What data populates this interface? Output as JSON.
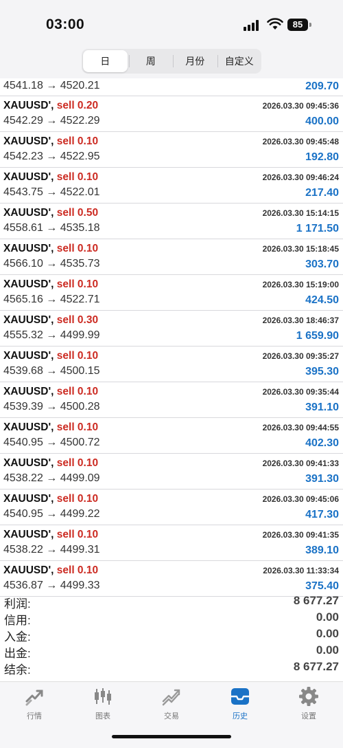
{
  "status": {
    "time": "03:00",
    "battery": "85"
  },
  "tabs": [
    "日",
    "周",
    "月份",
    "自定义"
  ],
  "partial_row": {
    "prices": "4541.18 → 4520.21",
    "profit": "209.70"
  },
  "rows": [
    {
      "symbol": "XAUUSD',",
      "side": "sell 0.20",
      "date": "2026.03.30 09:45:36",
      "prices": "4542.29 → 4522.29",
      "profit": "400.00"
    },
    {
      "symbol": "XAUUSD',",
      "side": "sell 0.10",
      "date": "2026.03.30 09:45:48",
      "prices": "4542.23 → 4522.95",
      "profit": "192.80"
    },
    {
      "symbol": "XAUUSD',",
      "side": "sell 0.10",
      "date": "2026.03.30 09:46:24",
      "prices": "4543.75 → 4522.01",
      "profit": "217.40"
    },
    {
      "symbol": "XAUUSD',",
      "side": "sell 0.50",
      "date": "2026.03.30 15:14:15",
      "prices": "4558.61 → 4535.18",
      "profit": "1 171.50"
    },
    {
      "symbol": "XAUUSD',",
      "side": "sell 0.10",
      "date": "2026.03.30 15:18:45",
      "prices": "4566.10 → 4535.73",
      "profit": "303.70"
    },
    {
      "symbol": "XAUUSD',",
      "side": "sell 0.10",
      "date": "2026.03.30 15:19:00",
      "prices": "4565.16 → 4522.71",
      "profit": "424.50"
    },
    {
      "symbol": "XAUUSD',",
      "side": "sell 0.30",
      "date": "2026.03.30 18:46:37",
      "prices": "4555.32 → 4499.99",
      "profit": "1 659.90"
    },
    {
      "symbol": "XAUUSD',",
      "side": "sell 0.10",
      "date": "2026.03.30 09:35:27",
      "prices": "4539.68 → 4500.15",
      "profit": "395.30"
    },
    {
      "symbol": "XAUUSD',",
      "side": "sell 0.10",
      "date": "2026.03.30 09:35:44",
      "prices": "4539.39 → 4500.28",
      "profit": "391.10"
    },
    {
      "symbol": "XAUUSD',",
      "side": "sell 0.10",
      "date": "2026.03.30 09:44:55",
      "prices": "4540.95 → 4500.72",
      "profit": "402.30"
    },
    {
      "symbol": "XAUUSD',",
      "side": "sell 0.10",
      "date": "2026.03.30 09:41:33",
      "prices": "4538.22 → 4499.09",
      "profit": "391.30"
    },
    {
      "symbol": "XAUUSD',",
      "side": "sell 0.10",
      "date": "2026.03.30 09:45:06",
      "prices": "4540.95 → 4499.22",
      "profit": "417.30"
    },
    {
      "symbol": "XAUUSD',",
      "side": "sell 0.10",
      "date": "2026.03.30 09:41:35",
      "prices": "4538.22 → 4499.31",
      "profit": "389.10"
    },
    {
      "symbol": "XAUUSD',",
      "side": "sell 0.10",
      "date": "2026.03.30 11:33:34",
      "prices": "4536.87 → 4499.33",
      "profit": "375.40"
    }
  ],
  "summary": [
    {
      "label": "利润:",
      "value": "8 677.27"
    },
    {
      "label": "信用:",
      "value": "0.00"
    },
    {
      "label": "入金:",
      "value": "0.00"
    },
    {
      "label": "出金:",
      "value": "0.00"
    },
    {
      "label": "结余:",
      "value": "8 677.27"
    }
  ],
  "nav": [
    {
      "label": "行情",
      "icon": "quotes-icon"
    },
    {
      "label": "图表",
      "icon": "candlestick-chart-icon"
    },
    {
      "label": "交易",
      "icon": "trade-icon"
    },
    {
      "label": "历史",
      "icon": "history-inbox-icon"
    },
    {
      "label": "设置",
      "icon": "gear-icon"
    }
  ],
  "colors": {
    "sell": "#cc2b22",
    "profit": "#1a72c6",
    "active_tab": "#1a72c6"
  }
}
